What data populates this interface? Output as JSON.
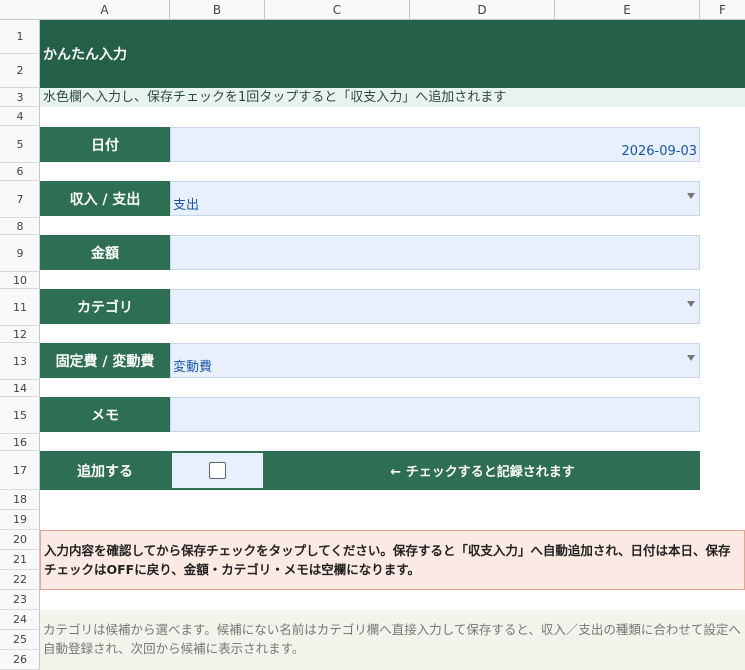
{
  "sheet": {
    "columns": [
      "A",
      "B",
      "C",
      "D",
      "E",
      "F"
    ],
    "rows": [
      "1",
      "2",
      "3",
      "4",
      "5",
      "6",
      "7",
      "8",
      "9",
      "10",
      "11",
      "12",
      "13",
      "14",
      "15",
      "16",
      "17",
      "18",
      "19",
      "20",
      "21",
      "22",
      "23",
      "24",
      "25",
      "26"
    ]
  },
  "header": {
    "title": "かんたん入力",
    "subtitle": "水色欄へ入力し、保存チェックを1回タップすると「収支入力」へ追加されます"
  },
  "form": {
    "date_label": "日付",
    "date_value": "2026-09-03",
    "type_label": "収入 / 支出",
    "type_value": "支出",
    "amount_label": "金額",
    "amount_value": "",
    "category_label": "カテゴリ",
    "category_value": "",
    "cost_label": "固定費 / 変動費",
    "cost_value": "変動費",
    "memo_label": "メモ",
    "memo_value": "",
    "add_label": "追加する",
    "add_hint": "← チェックすると記録されます"
  },
  "notices": {
    "warning": "入力内容を確認してから保存チェックをタップしてください。保存すると「収支入力」へ自動追加され、日付は本日、保存チェックはOFFに戻り、金額・カテゴリ・メモは空欄になります。",
    "info": "カテゴリは候補から選べます。候補にない名前はカテゴリ欄へ直接入力して保存すると、収入／支出の種類に合わせて設定へ自動登録され、次回から候補に表示されます。"
  },
  "colors": {
    "banner": "#236047",
    "label": "#2e6e52",
    "field": "#e8f0fe",
    "warning_bg": "#fbe9e3",
    "info_bg": "#f3f3ec"
  },
  "icons": [
    "dropdown-arrow-icon",
    "checkbox-icon",
    "left-arrow-icon"
  ]
}
